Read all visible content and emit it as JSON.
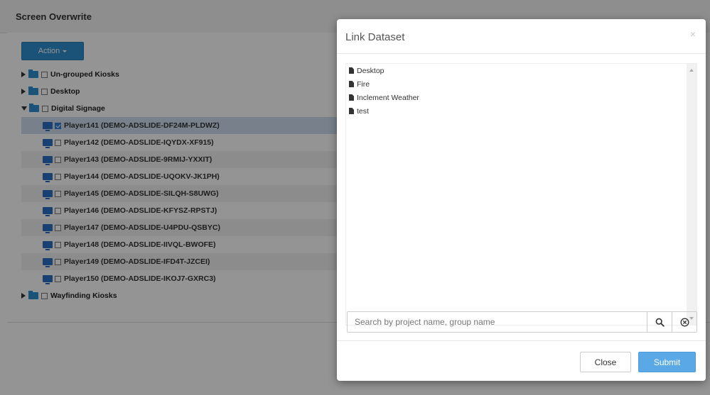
{
  "panel": {
    "title": "Screen Overwrite",
    "action_label": "Action"
  },
  "tree": {
    "groups": [
      {
        "label": "Un-grouped Kiosks",
        "expanded": false
      },
      {
        "label": "Desktop",
        "expanded": false
      },
      {
        "label": "Digital Signage",
        "expanded": true
      },
      {
        "label": "Wayfinding Kiosks",
        "expanded": false
      }
    ],
    "players": [
      {
        "label": "Player141 (DEMO-ADSLIDE-DF24M-PLDWZ)",
        "checked": true
      },
      {
        "label": "Player142 (DEMO-ADSLIDE-IQYDX-XF915)",
        "checked": false
      },
      {
        "label": "Player143 (DEMO-ADSLIDE-9RMIJ-YXXIT)",
        "checked": false
      },
      {
        "label": "Player144 (DEMO-ADSLIDE-UQOKV-JK1PH)",
        "checked": false
      },
      {
        "label": "Player145 (DEMO-ADSLIDE-SILQH-S8UWG)",
        "checked": false
      },
      {
        "label": "Player146 (DEMO-ADSLIDE-KFYSZ-RPSTJ)",
        "checked": false
      },
      {
        "label": "Player147 (DEMO-ADSLIDE-U4PDU-QSBYC)",
        "checked": false
      },
      {
        "label": "Player148 (DEMO-ADSLIDE-IIVQL-BWOFE)",
        "checked": false
      },
      {
        "label": "Player149 (DEMO-ADSLIDE-IFD4T-JZCEI)",
        "checked": false
      },
      {
        "label": "Player150 (DEMO-ADSLIDE-IKOJ7-GXRC3)",
        "checked": false
      }
    ]
  },
  "modal": {
    "title": "Link Dataset",
    "close_glyph": "×",
    "datasets": [
      "Desktop",
      "Fire",
      "Inclement Weather",
      "test"
    ],
    "search": {
      "placeholder": "Search by project name, group name",
      "value": ""
    },
    "close_label": "Close",
    "submit_label": "Submit"
  },
  "colors": {
    "action_blue": "#2f8fcf",
    "submit_blue": "#5aa9e6",
    "selected_row": "#cfdff0"
  }
}
